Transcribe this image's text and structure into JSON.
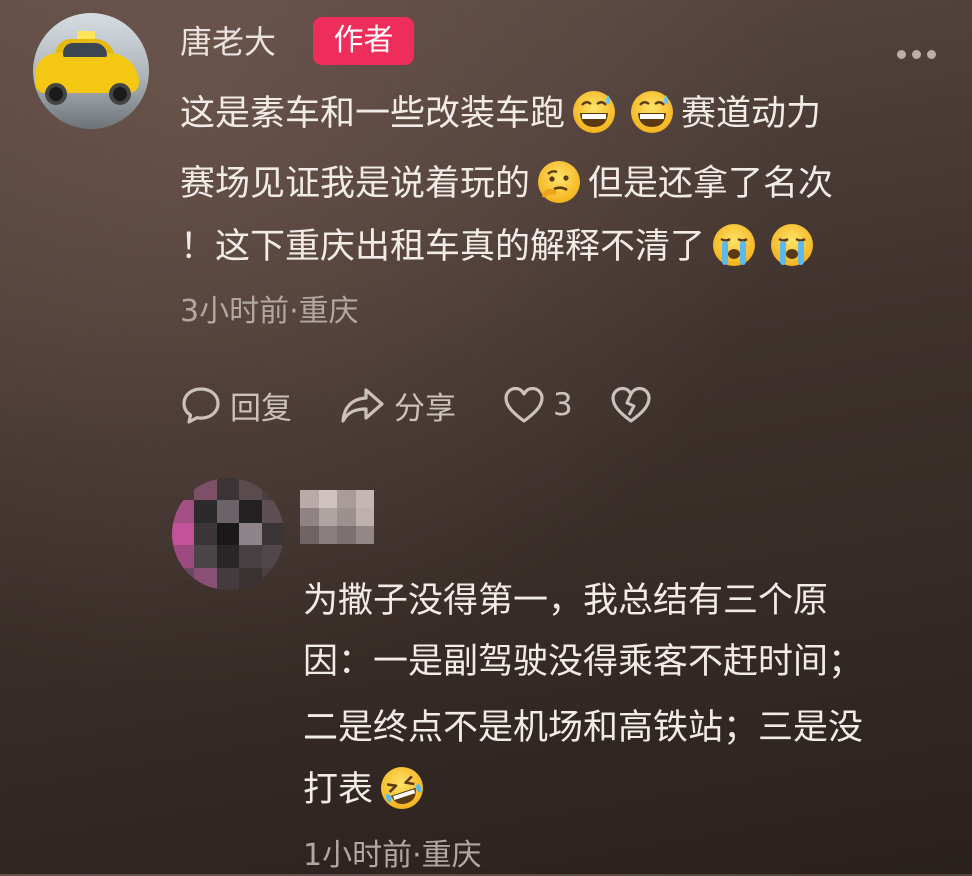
{
  "comment": {
    "username": "唐老大",
    "author_badge": "作者",
    "text": {
      "line1_a": "这是素车和一些改装车跑",
      "line1_b": "赛道动力",
      "line2_a": "赛场见证我是说着玩的",
      "line2_b": "但是还拿了名次",
      "line3_a": "！这下重庆出租车真的解释不清了"
    },
    "meta": "3小时前·重庆",
    "actions": {
      "reply_label": "回复",
      "share_label": "分享",
      "like_count": "3"
    }
  },
  "reply": {
    "text": {
      "line1": "为撒子没得第一，我总结有三个原",
      "line2": "因：一是副驾驶没得乘客不赶时间；",
      "line3": "二是终点不是机场和高铁站；三是没",
      "line4_a": "打表"
    },
    "meta": "1小时前·重庆"
  },
  "icons": {
    "more": "more-dots-icon",
    "reply": "comment-bubble-icon",
    "share": "share-arrow-icon",
    "like": "heart-icon",
    "dislike": "broken-heart-icon",
    "emoji_sweat": "grin-sweat-emoji",
    "emoji_thinking": "thinking-emoji",
    "emoji_crying": "loudly-crying-emoji",
    "emoji_laugh_cry": "rolling-laughing-emoji"
  },
  "colors": {
    "author_badge": "#ef2d5b",
    "text": "#f2ece8",
    "meta": "#b3a7a2"
  }
}
